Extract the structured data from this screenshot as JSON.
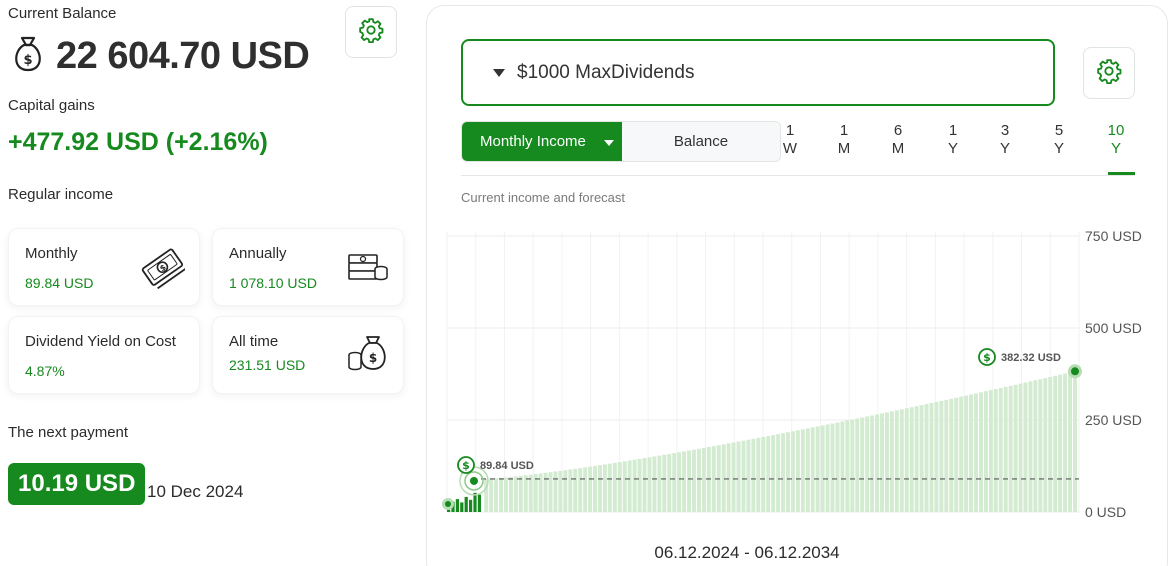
{
  "balance": {
    "label": "Current Balance",
    "value": "22 604.70 USD",
    "gains_label": "Capital gains",
    "gains_value": "+477.92 USD (+2.16%)"
  },
  "regular_income": {
    "label": "Regular income",
    "cards": [
      {
        "title": "Monthly",
        "value": "89.84 USD",
        "icon": "banknotes-icon"
      },
      {
        "title": "Annually",
        "value": "1 078.10 USD",
        "icon": "money-stack-icon"
      },
      {
        "title": "Dividend Yield on Cost",
        "value": "4.87%"
      },
      {
        "title": "All time",
        "value": "231.51 USD",
        "icon": "money-bag-coins-icon"
      }
    ]
  },
  "next_payment": {
    "label": "The next payment",
    "amount": "10.19 USD",
    "date": "10 Dec 2024"
  },
  "portfolio": {
    "selected": "$1000 MaxDividends"
  },
  "view_toggle": {
    "active": "Monthly Income",
    "inactive": "Balance"
  },
  "periods": [
    {
      "l1": "1",
      "l2": "W"
    },
    {
      "l1": "1",
      "l2": "M"
    },
    {
      "l1": "6",
      "l2": "M"
    },
    {
      "l1": "1",
      "l2": "Y"
    },
    {
      "l1": "3",
      "l2": "Y"
    },
    {
      "l1": "5",
      "l2": "Y"
    },
    {
      "l1": "10",
      "l2": "Y"
    }
  ],
  "active_period": "10 Y",
  "chart_subtitle": "Current income and forecast",
  "date_range": "06.12.2024 - 06.12.2034",
  "colors": {
    "accent": "#168a1e",
    "bar_light": "#d3ebd1",
    "bar_dark": "#168a1e"
  },
  "chart_data": {
    "type": "bar",
    "title": "",
    "subtitle": "Current income and forecast",
    "y_ticks": [
      "750 USD",
      "500 USD",
      "250 USD",
      "0 USD"
    ],
    "ylim": [
      0,
      750
    ],
    "start_value": 89.84,
    "end_value": 382.32,
    "start_label": "89.84 USD",
    "end_label": "382.32 USD",
    "reference_line": 89.84,
    "historical_values": [
      15,
      28,
      35,
      26,
      41,
      33,
      52,
      47
    ],
    "forecast_months": 120,
    "x_range_label": "06.12.2024 - 06.12.2034",
    "grid": true
  }
}
